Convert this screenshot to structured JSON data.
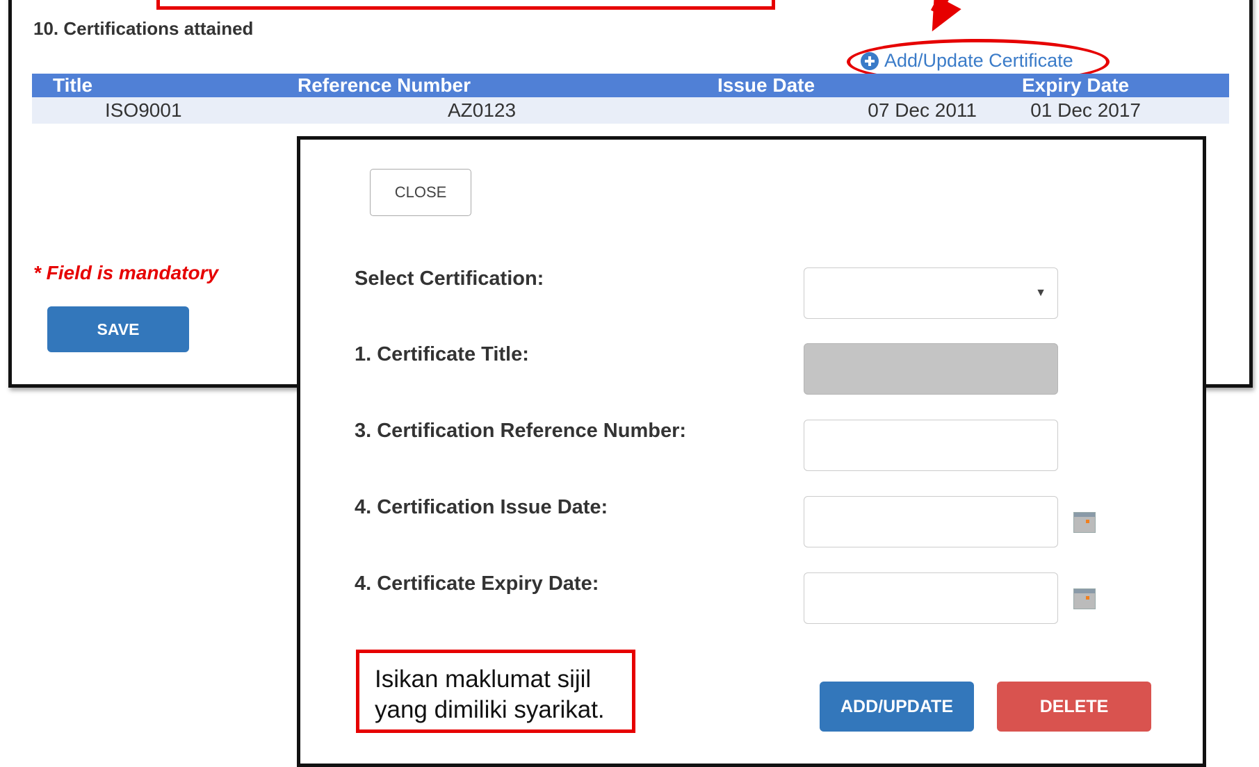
{
  "section": {
    "title": "10. Certifications attained",
    "add_link_label": "Add/Update Certificate"
  },
  "table": {
    "headers": [
      "Title",
      "Reference Number",
      "Issue Date",
      "Expiry Date"
    ],
    "rows": [
      [
        "ISO9001",
        "AZ0123",
        "07 Dec 2011",
        "01 Dec 2017"
      ]
    ]
  },
  "mandatory_note": "* Field is mandatory",
  "save_label": "SAVE",
  "modal": {
    "close_label": "CLOSE",
    "select_label": "Select Certification:",
    "select_value": "",
    "title_label": "1. Certificate Title:",
    "title_value": "",
    "ref_label": "3. Certification Reference Number:",
    "ref_value": "",
    "issue_label": "4. Certification Issue Date:",
    "issue_value": "",
    "expiry_label": "4. Certificate Expiry Date:",
    "expiry_value": "",
    "add_label": "ADD/UPDATE",
    "delete_label": "DELETE"
  },
  "callout_text": "Isikan maklumat sijil yang dimiliki syarikat.",
  "icons": {
    "add": "plus-circle-icon",
    "calendar": "calendar-icon",
    "caret": "chevron-down-icon"
  },
  "colors": {
    "header_bg": "#5080d6",
    "row_bg": "#e9eef8",
    "primary": "#3377bb",
    "danger": "#d9534f",
    "highlight": "#e60000"
  }
}
